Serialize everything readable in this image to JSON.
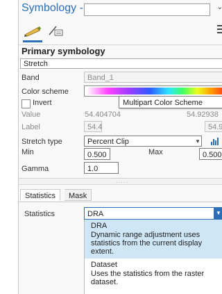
{
  "pane": {
    "title": "Symbology -",
    "title_input_value": ""
  },
  "toolbar": {
    "primary_icon": "pencil-symbol-icon",
    "secondary_icon": "vary-symbology-icon",
    "menu_icon": "hamburger-menu-icon"
  },
  "primary": {
    "heading": "Primary symbology",
    "renderer": "Stretch",
    "band_label": "Band",
    "band_value": "Band_1",
    "color_scheme_label": "Color scheme",
    "tooltip": "Multipart Color Scheme",
    "invert_label": "Invert",
    "invert_checked": false,
    "value_label": "Value",
    "value_min": "54.404704",
    "value_max": "54.92938",
    "label_label": "Label",
    "label_min": "54.4",
    "label_max": "54.9",
    "stretch_type_label": "Stretch type",
    "stretch_type_value": "Percent Clip",
    "min_label": "Min",
    "min_value": "0.500",
    "max_label": "Max",
    "max_value": "0.500",
    "gamma_label": "Gamma",
    "gamma_value": "1.0"
  },
  "tabs": [
    {
      "label": "Statistics",
      "active": true
    },
    {
      "label": "Mask",
      "active": false
    }
  ],
  "statistics": {
    "label": "Statistics",
    "selected": "DRA",
    "options": [
      {
        "title": "DRA",
        "description": "Dynamic range adjustment uses statistics from the current display extent."
      },
      {
        "title": "Dataset",
        "description": "Uses the statistics from the raster dataset."
      }
    ]
  },
  "colors": {
    "accent": "#2c6fb6",
    "selected_option_bg": "#cfe6f6"
  }
}
